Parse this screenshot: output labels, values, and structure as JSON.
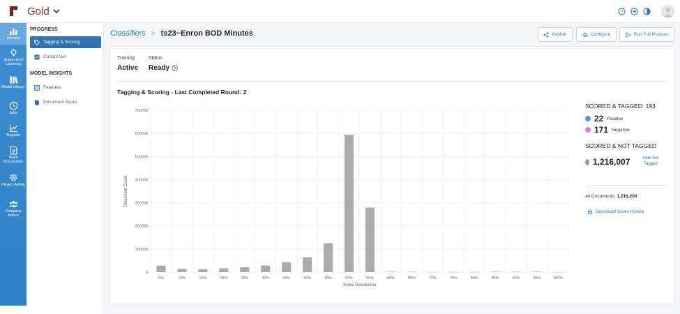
{
  "topbar": {
    "workspace": "Gold",
    "icons": [
      "help-icon",
      "cloud-icon",
      "theme-icon"
    ]
  },
  "rail": [
    {
      "label": "Review",
      "icon": "bar-chart-icon",
      "active": true
    },
    {
      "label": "Supervised Learning",
      "icon": "lightbulb-icon"
    },
    {
      "label": "Model Library",
      "icon": "library-icon"
    },
    {
      "label": "Jobs",
      "icon": "clock-icon"
    },
    {
      "label": "Reports",
      "icon": "line-chart-icon"
    },
    {
      "label": "Team Documents",
      "icon": "document-icon"
    },
    {
      "label": "Project Admin",
      "icon": "gear-icon"
    },
    {
      "label": "Company Admin",
      "icon": "people-icon"
    }
  ],
  "subnav": {
    "progress_title": "PROGRESS",
    "tagging_scoring": "Tagging & Scoring",
    "control_set": "Control Set",
    "insights_title": "MODEL INSIGHTS",
    "features": "Features",
    "document_score": "Document Score"
  },
  "breadcrumb": {
    "root": "Classifiers",
    "separator": ">",
    "current": "ts23~Enron BOD Minutes"
  },
  "actions": {
    "publish": "Publish",
    "configure": "Configure",
    "run_full_process": "Run Full Process"
  },
  "status": {
    "training_label": "Training",
    "training_value": "Active",
    "status_label": "Status",
    "status_value": "Ready"
  },
  "chart_title": "Tagging & Scoring - Last Completed Round: 2",
  "chart_data": {
    "type": "bar",
    "categories": [
      "5%",
      "10%",
      "15%",
      "20%",
      "25%",
      "30%",
      "35%",
      "40%",
      "45%",
      "50%",
      "55%",
      "60%",
      "65%",
      "70%",
      "75%",
      "80%",
      "85%",
      "90%",
      "95%",
      "100%"
    ],
    "values": [
      28000,
      14000,
      13000,
      17000,
      21000,
      29000,
      43000,
      64000,
      125000,
      594000,
      279000,
      2000,
      1500,
      1000,
      1000,
      500,
      2000,
      2000,
      2000,
      500
    ],
    "y_ticks": [
      "0",
      "100000",
      "200000",
      "300000",
      "400000",
      "500000",
      "600000",
      "700000"
    ],
    "ylim": [
      0,
      700000
    ],
    "xlabel": "Score Distribution",
    "ylabel": "Document Count",
    "grid": true,
    "colors": {
      "bar": "#ababab",
      "grid": "#e6e6e6"
    }
  },
  "summary": {
    "scored_tagged_label": "SCORED & TAGGED: 193",
    "positive_count": "22",
    "positive_label": "Positive",
    "negative_count": "171",
    "negative_label": "Negative",
    "scored_not_tagged_label": "SCORED & NOT TAGGED",
    "not_tagged_count": "1,216,007",
    "hide_not_tagged": "Hide Not Tagged",
    "all_documents_label": "All Documents:",
    "all_documents_value": "1,216,200",
    "download_label": "Download Score History",
    "colors": {
      "positive": "#4f97d8",
      "negative": "#d882d8",
      "not_tagged": "#9a9a9a"
    }
  }
}
